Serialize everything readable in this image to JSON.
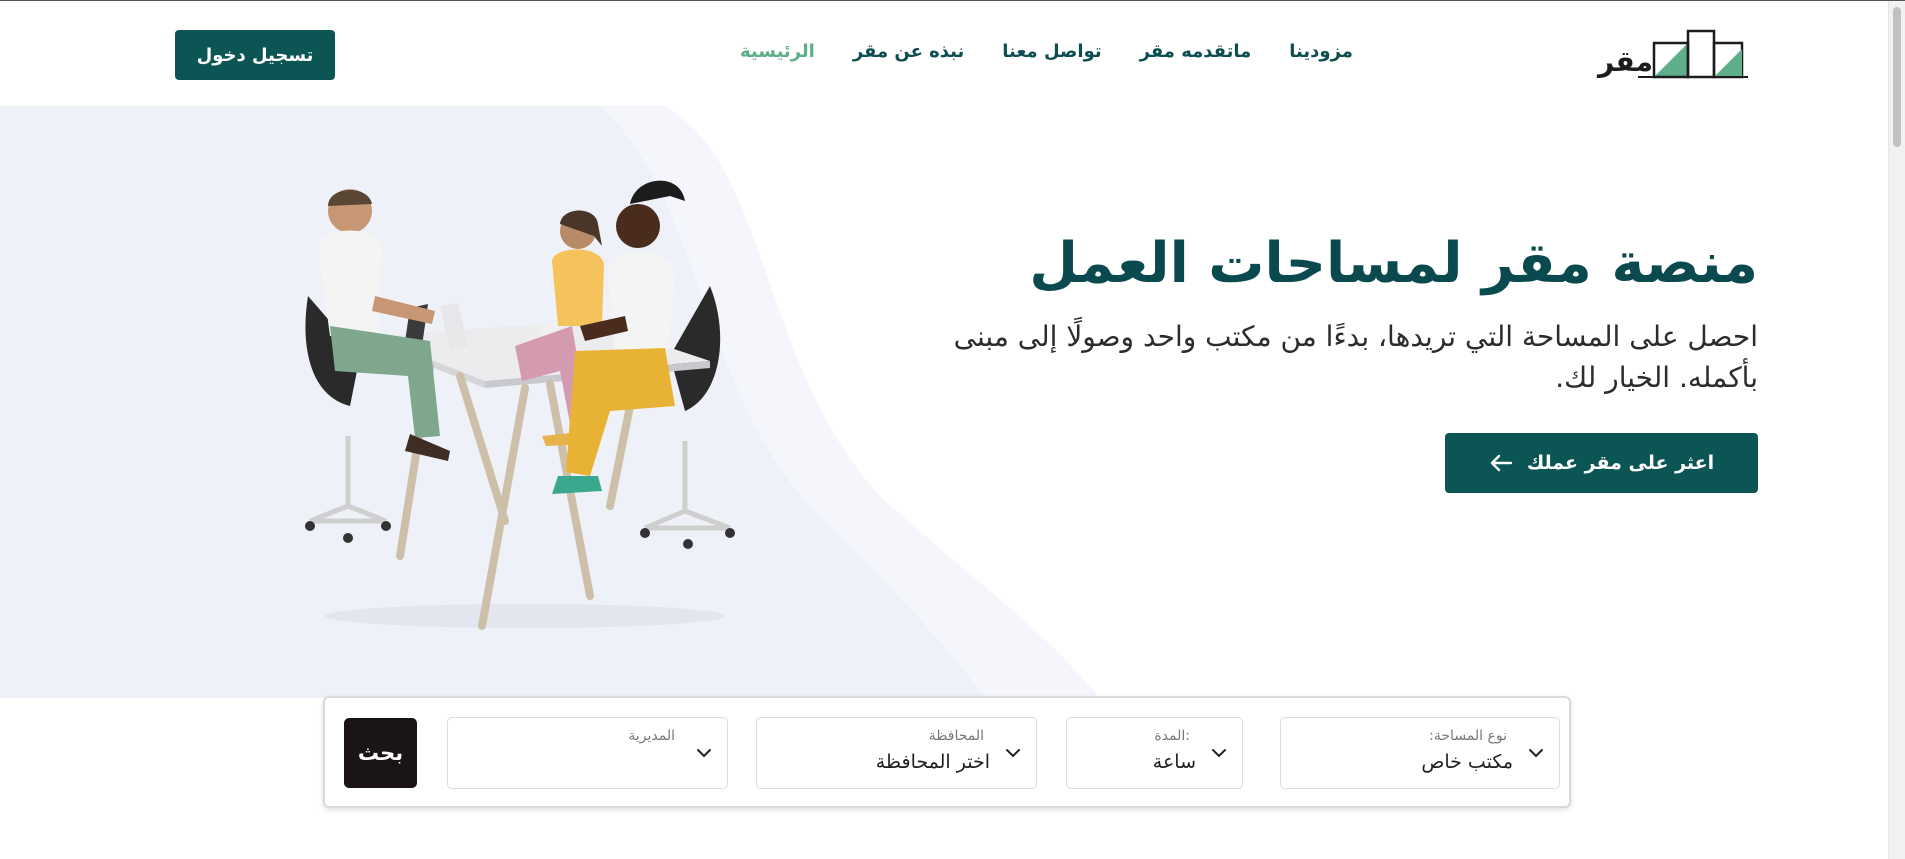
{
  "header": {
    "logo_text": "مقر",
    "nav": [
      {
        "label": "الرئيسية",
        "active": true
      },
      {
        "label": "نبذه عن مقر",
        "active": false
      },
      {
        "label": "تواصل معنا",
        "active": false
      },
      {
        "label": "ماتقدمه مقر",
        "active": false
      },
      {
        "label": "مزودينا",
        "active": false
      }
    ],
    "login_label": "تسجيل دخول"
  },
  "hero": {
    "title": "منصة مقر لمساحات العمل",
    "subtitle": "احصل على المساحة التي تريدها، بدءًا من مكتب واحد وصولًا إلى مبنى بأكمله. الخيار لك.",
    "cta_label": "اعثر على مقر عملك",
    "cta_icon": "arrow-left-icon"
  },
  "search": {
    "space_type": {
      "label": "نوع المساحة:",
      "value": "مكتب خاص"
    },
    "duration": {
      "label": ":المدة",
      "value": "ساعة"
    },
    "governorate": {
      "label": "المحافظة",
      "value": "اختر المحافظة"
    },
    "directorate": {
      "label": "المديرية",
      "value": ""
    },
    "button_label": "بحث"
  },
  "colors": {
    "primary": "#0b5555",
    "active_nav": "#5fae8a",
    "hero_bg": "#eef1f8",
    "search_button": "#1b1414"
  }
}
